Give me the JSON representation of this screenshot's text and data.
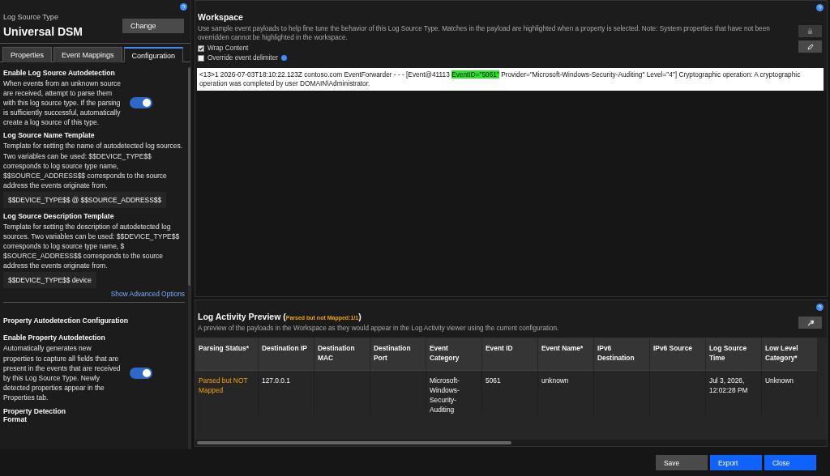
{
  "left_panel": {
    "label": "Log Source Type",
    "title": "Universal DSM",
    "change_button": "Change",
    "tabs": [
      {
        "label": "Properties",
        "selected": false
      },
      {
        "label": "Event Mappings",
        "selected": false
      },
      {
        "label": "Configuration",
        "selected": true
      }
    ],
    "sections": [
      {
        "kind": "toggle",
        "heading": "Enable Log Source Autodetection",
        "text": "When events from an unknown source are received, attempt to parse them with this log source type. If the parsing is sufficiently successful, automatically create a log source of this type.",
        "on": true
      },
      {
        "kind": "template",
        "heading": "Log Source Name Template",
        "text": "Template for setting the name of autodetected log sources. Two variables can be used: $$DEVICE_TYPE$$ corresponds to log source type name, $$SOURCE_ADDRESS$$ corresponds to the source address the events originate from.",
        "value": "$$DEVICE_TYPE$$ @ $$SOURCE_ADDRESS$$"
      },
      {
        "kind": "template",
        "heading": "Log Source Description Template",
        "text": "Template for setting the description of autodetected log sources. Two variables can be used: $$DEVICE_TYPE$$ corresponds to log source type name, $ $SOURCE_ADDRESS$$ corresponds to the source address the events originate from.",
        "value": "$$DEVICE_TYPE$$ device"
      },
      {
        "kind": "link",
        "text": "Show Advanced Options"
      },
      {
        "kind": "title",
        "text": "Property Autodetection Configuration"
      },
      {
        "kind": "toggle",
        "heading": "Enable Property Autodetection",
        "text": "Automatically generates new properties to capture all fields that are present in the events that are received by this Log Source Type. Newly detected properties appear in the Properties tab.",
        "on": true
      },
      {
        "kind": "heading",
        "text": "Property Detection Format"
      }
    ]
  },
  "workspace": {
    "title": "Workspace",
    "description": "Use sample event payloads to help fine tune the behavior of this Log Source Type. Matches in the payload are highlighted when a property is selected. Note: System properties that have not been overridden cannot be highlighted in the workspace.",
    "options": [
      {
        "label": "Wrap Content",
        "checked": true,
        "info": false
      },
      {
        "label": "Override event delimiter",
        "checked": false,
        "info": true
      }
    ],
    "payload": [
      {
        "text": "<13>1 2026-07-03T18:10:22.123Z contoso.com EventForwarder - - - [Event@41113 ",
        "highlighted": false
      },
      {
        "text": "EventID=\"5061\"",
        "highlighted": true
      },
      {
        "text": " Provider=\"Microsoft-Windows-Security-Auditing\" Level=\"4\"] Cryptographic operation: A cryptographic operation was completed by user DOMAIN\\Administrator.",
        "highlighted": false
      }
    ]
  },
  "preview": {
    "title": "Log Activity Preview",
    "status_open": "(",
    "status": "Parsed but not Mapped:1/1",
    "status_close": ")",
    "description": "A preview of the payloads in the Workspace as they would appear in the Log Activity viewer using the current configuration.",
    "table": {
      "columns": [
        "Parsing Status*",
        "Destination IP",
        "Destination MAC",
        "Destination Port",
        "Event Category",
        "Event ID",
        "Event Name*",
        "IPv6 Destination",
        "IPv6 Source",
        "Log Source Time",
        "Low Level Category*"
      ],
      "rows": [
        {
          "warning": true,
          "cells": [
            "Parsed but NOT Mapped",
            "127.0.0.1",
            "",
            "",
            "Microsoft-Windows-Security-Auditing",
            "5061",
            "unknown",
            "",
            "",
            "Jul 3, 2026, 12:02:28 PM",
            "Unknown"
          ]
        }
      ]
    }
  },
  "buttons": [
    {
      "label": "Save",
      "kind": "secondary"
    },
    {
      "label": "Export",
      "kind": "primary"
    },
    {
      "label": "Close",
      "kind": "primary"
    }
  ]
}
